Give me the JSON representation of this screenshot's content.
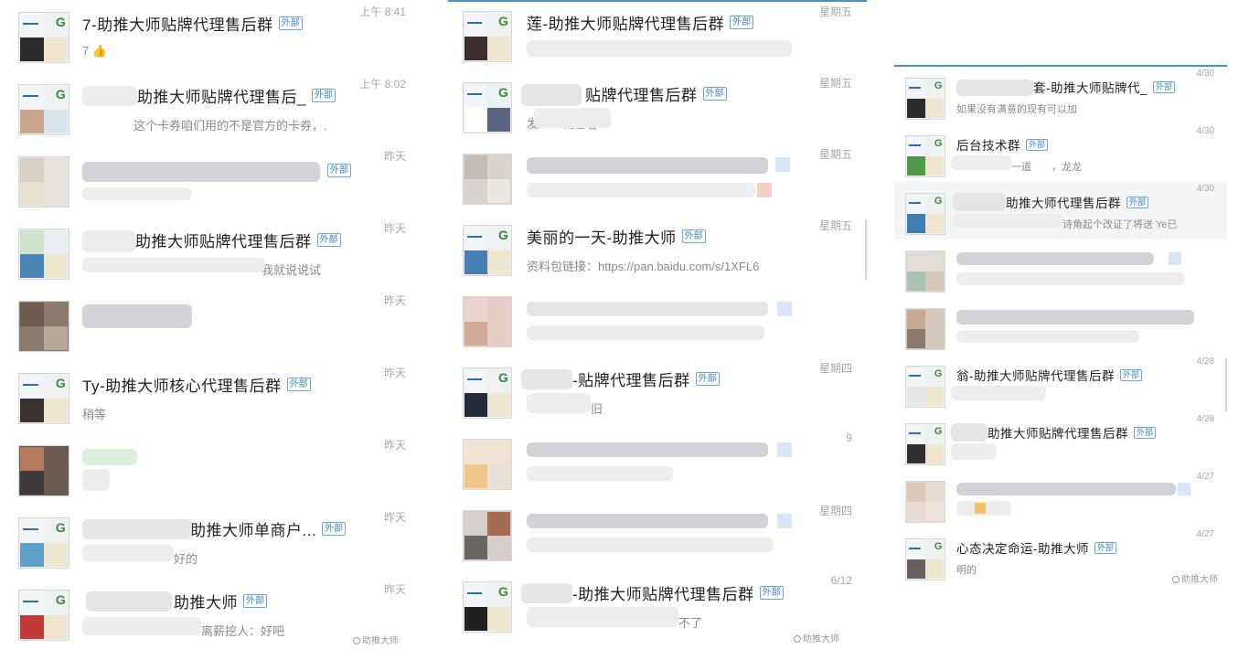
{
  "column1": [
    {
      "name": "7-助推大师贴牌代理售后群",
      "tag": "外部",
      "preview": "7",
      "emoji": "👍",
      "time": "上午 8:41"
    },
    {
      "name": "助推大师贴牌代理售后_",
      "tag": "外部",
      "preview": "这个卡券咱们用的不是官方的卡券，.",
      "time": "上午 8:02"
    },
    {
      "name": "",
      "tag": "外部",
      "preview": "",
      "time": "昨天"
    },
    {
      "name": "助推大师贴牌代理售后群",
      "tag": "外部",
      "preview": "我就说说试",
      "time": "昨天"
    },
    {
      "name": "",
      "tag": "",
      "preview": "",
      "time": "昨天"
    },
    {
      "name": "Ty-助推大师核心代理售后群",
      "tag": "外部",
      "preview": "稍等",
      "time": "昨天"
    },
    {
      "name": "",
      "tag": "",
      "preview": "",
      "time": "昨天"
    },
    {
      "name": "助推大师单商户...",
      "tag": "外部",
      "preview": "好的",
      "time": "昨天"
    },
    {
      "name": "助推大师",
      "tag": "外部",
      "preview": "离薪挖人：好吧",
      "time": "昨天"
    }
  ],
  "column2": [
    {
      "name": "莲-助推大师贴牌代理售后群",
      "tag": "外部",
      "preview": "",
      "time": "星期五"
    },
    {
      "name": "贴牌代理售后群",
      "tag": "外部",
      "preview": "发　　销着着",
      "time": "星期五"
    },
    {
      "name": "",
      "tag": "",
      "preview": "",
      "time": "星期五"
    },
    {
      "name": "美丽的一天-助推大师",
      "tag": "外部",
      "preview": "资料包链接：https://pan.baidu.com/s/1XFL6",
      "time": "星期五"
    },
    {
      "name": "",
      "tag": "",
      "preview": "",
      "time": ""
    },
    {
      "name": "-贴牌代理售后群",
      "tag": "外部",
      "preview": "旧",
      "time": "星期四"
    },
    {
      "name": "",
      "tag": "",
      "preview": "",
      "time": "9"
    },
    {
      "name": "",
      "tag": "",
      "preview": "",
      "time": "星期四"
    },
    {
      "name": "-助推大师贴牌代理售后群",
      "tag": "外部",
      "preview": "不了",
      "time": "6/12"
    }
  ],
  "column3": [
    {
      "name": "套-助推大师贴牌代_",
      "tag": "外部",
      "preview": "如果没有满意的现有可以加",
      "time": "4/30"
    },
    {
      "name": "后台技术群",
      "tag": "外部",
      "preview": "一道　　，龙龙",
      "time": "4/30"
    },
    {
      "name": "助推大师代理售后群",
      "tag": "外部",
      "preview": "诗角起个改证了将送 Ye已",
      "time": "4/30"
    },
    {
      "name": "",
      "tag": "",
      "preview": "",
      "time": ""
    },
    {
      "name": "",
      "tag": "",
      "preview": "",
      "time": ""
    },
    {
      "name": "翁-助推大师贴牌代理售后群",
      "tag": "外部",
      "preview": "",
      "time": "4/28"
    },
    {
      "name": "助推大师贴牌代理售后群",
      "tag": "外部",
      "preview": "",
      "time": "4/28"
    },
    {
      "name": "",
      "tag": "",
      "preview": "",
      "time": "4/27"
    },
    {
      "name": "心态决定命运-助推大师",
      "tag": "外部",
      "preview": "明的",
      "time": "4/27"
    }
  ],
  "watermarks": [
    "助推大师",
    "助推大师",
    "助推大师"
  ],
  "colors": {
    "accent_line": "#4a90c8",
    "tag_border": "#6aa7dc",
    "tag_text": "#3c86c8",
    "time_gray": "#a8a8a8"
  }
}
